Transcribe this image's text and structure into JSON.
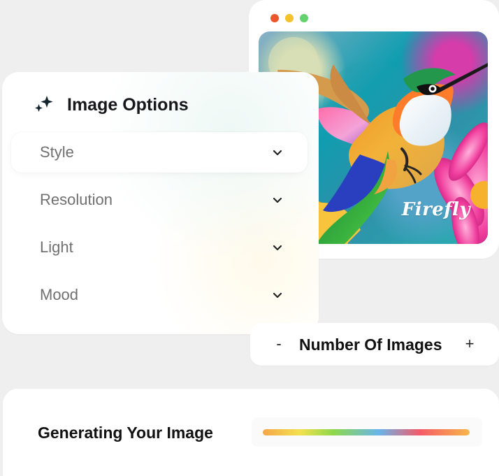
{
  "preview": {
    "window_controls": [
      {
        "name": "close-dot",
        "color": "#e9572a"
      },
      {
        "name": "minimize-dot",
        "color": "#f6c22b"
      },
      {
        "name": "maximize-dot",
        "color": "#65d36d"
      }
    ],
    "watermark": "Firefly",
    "image_icon": "hummingbird-image"
  },
  "options_panel": {
    "title": "Image Options",
    "icon": "sparkle-icon",
    "items": [
      {
        "label": "Style",
        "icon": "chevron-down-icon",
        "active": true
      },
      {
        "label": "Resolution",
        "icon": "chevron-down-icon",
        "active": false
      },
      {
        "label": "Light",
        "icon": "chevron-down-icon",
        "active": false
      },
      {
        "label": "Mood",
        "icon": "chevron-down-icon",
        "active": false
      }
    ]
  },
  "number_images": {
    "decrement": "-",
    "label": "Number Of Images",
    "increment": "+"
  },
  "generation": {
    "label": "Generating Your Image",
    "progress": 1,
    "gradient_colors": [
      "#f5a64a",
      "#f3e14e",
      "#8ed84a",
      "#68b5ea",
      "#f55b68",
      "#f7b64a"
    ]
  }
}
